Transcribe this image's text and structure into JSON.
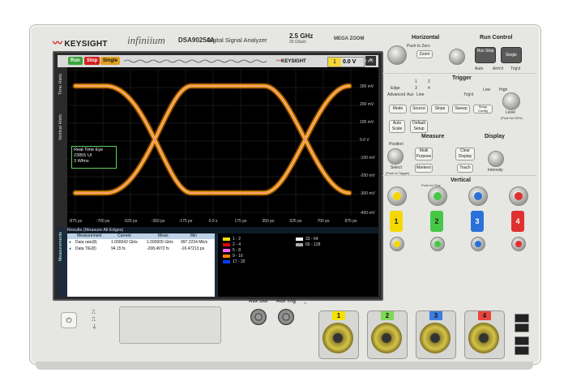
{
  "header": {
    "brand": "KEYSIGHT",
    "product_line": "infiniium",
    "model": "DSA90254A",
    "model_description": "Digital Signal Analyzer",
    "sample_rate": "2.5 GHz",
    "sample_rate_sub": "20 GSa/s",
    "megazoom": "MEGA ZOOM"
  },
  "screen": {
    "buttons": {
      "run": "Run",
      "stop": "Stop",
      "single": "Single"
    },
    "logo_text": "KEYSIGHT",
    "trigger_level": "0.0 V",
    "side_tabs": [
      "Time Histo",
      "Vertical Histo"
    ],
    "bottom_tab": "Measurements",
    "y_ticks": [
      "400 mV",
      "300 mV",
      "200 mV",
      "100 mV",
      "0.0 V",
      "-100 mV",
      "-200 mV",
      "-300 mV",
      "-400 mV"
    ],
    "x_ticks": [
      "-875 ps",
      "-700 ps",
      "-525 ps",
      "-350 ps",
      "-175 ps",
      "0.0 s",
      "175 ps",
      "350 ps",
      "525 ps",
      "700 ps",
      "875 ps"
    ],
    "eye_label": {
      "title": "Real-Time Eye",
      "line1": "23855 UI",
      "line2": "3 Wfms"
    },
    "results": {
      "header": "Results  (Measure All Edges)",
      "columns": [
        "Measurement",
        "Current",
        "Mean",
        "Min"
      ],
      "rows": [
        {
          "name": "Data rate(8)",
          "current": "1.000042 Gb/s",
          "mean": "1.000005 Gb/s",
          "min": "997.2234 Mb/s"
        },
        {
          "name": "Data TIE(8)",
          "current": "94.15 fs",
          "mean": "-208.4972 fs",
          "min": "-16.47213 ps"
        }
      ]
    },
    "legend": [
      {
        "label": "1 - 2",
        "color": "#f5e000"
      },
      {
        "label": "2 - 4",
        "color": "#e00000"
      },
      {
        "label": "5 - 8",
        "color": "#ff60ff"
      },
      {
        "label": "9 - 16",
        "color": "#ff8000"
      },
      {
        "label": "17 - 32",
        "color": "#0040ff"
      },
      {
        "label": "33 - 64",
        "color": "#ffffff"
      },
      {
        "label": "65 - 128",
        "color": "#aaaaaa"
      }
    ]
  },
  "panel": {
    "horizontal": "Horizontal",
    "push_to_zero": "Push to Zero",
    "zoom": "Zoom",
    "run_control": "Run Control",
    "run_stop": "Run Stop",
    "single": "Single",
    "auto_labels": [
      "Auto",
      "Arm'd",
      "Trig'd"
    ],
    "trigger": "Trigger",
    "trig_modes": [
      "Edge",
      "Advanced",
      "Aux",
      "Line"
    ],
    "trig_nums": [
      "1",
      "2",
      "3",
      "4"
    ],
    "trig_levels": [
      "Trig'd",
      "Low",
      "High"
    ],
    "trig_buttons": [
      "Mode",
      "Source",
      "Slope",
      "Sweep",
      "Setup Config"
    ],
    "level": "Level",
    "level_sub": "(Push for 50%)",
    "auto_scale": "Auto Scale",
    "default_setup": "Default Setup",
    "measure": "Measure",
    "display": "Display",
    "position": "Position",
    "select": "Select",
    "select_sub": "(Push to Toggle)",
    "multi_purpose": "Multi Purpose",
    "clear_display": "Clear Display",
    "markers": "Markers",
    "touch": "Touch",
    "intensity": "Intensity",
    "vertical": "Vertical",
    "push_fine": "Push for Fine",
    "channels": [
      "1",
      "2",
      "3",
      "4"
    ],
    "channel_colors": [
      "#f5d800",
      "#46c846",
      "#2a72d8",
      "#e03030"
    ]
  },
  "front": {
    "aux_out": "Aux Out",
    "aux_trig": "Aux Trig",
    "inputs": [
      "1",
      "2",
      "3",
      "4"
    ],
    "input_colors": [
      "#f5e100",
      "#7ed956",
      "#3d7de0",
      "#e8453c"
    ]
  }
}
